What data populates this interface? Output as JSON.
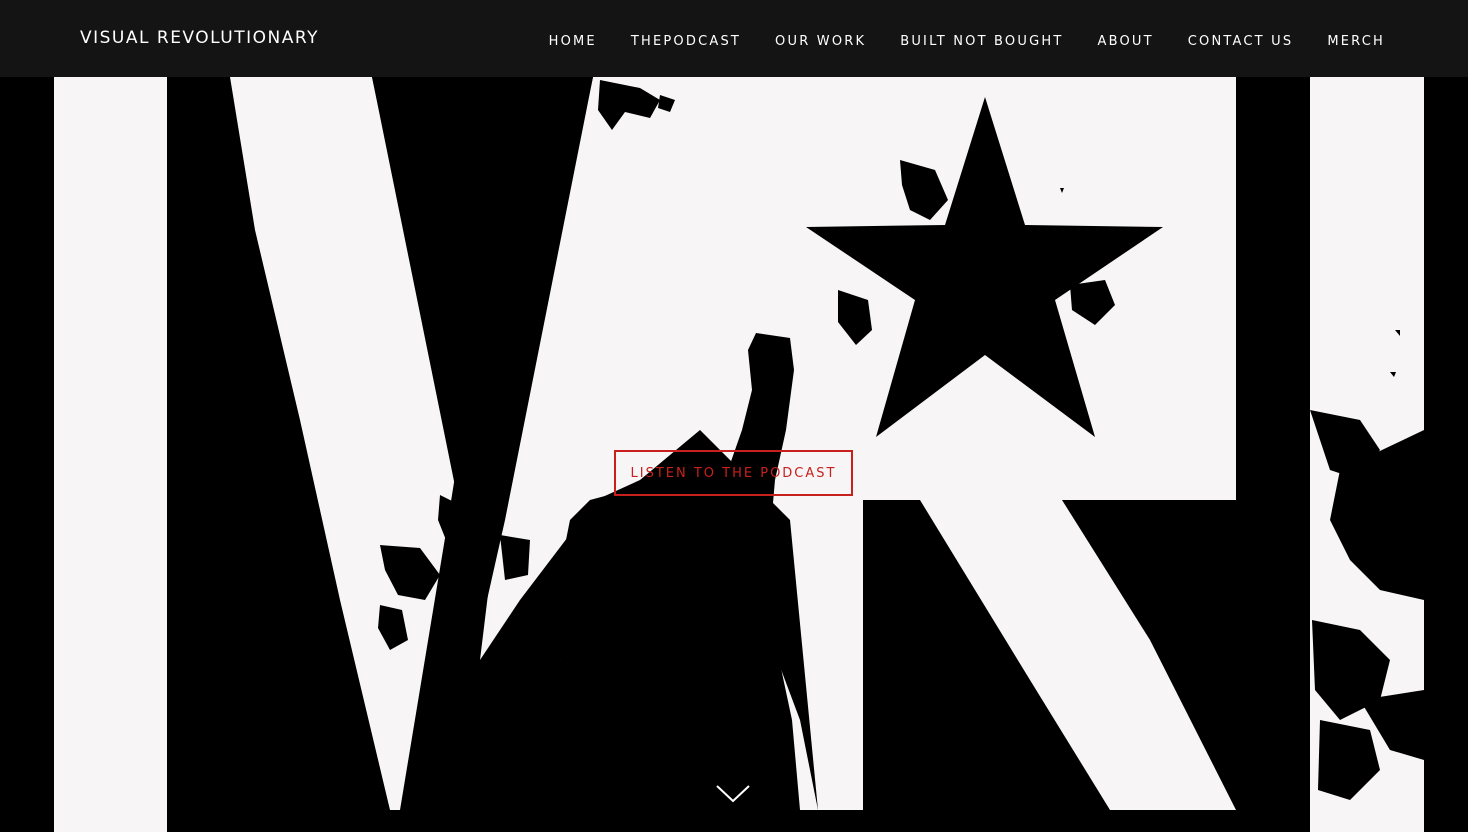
{
  "brand": {
    "title": "VISUAL REVOLUTIONARY"
  },
  "nav": {
    "items": [
      {
        "label": "HOME"
      },
      {
        "label": "THEPODCAST"
      },
      {
        "label": "OUR WORK"
      },
      {
        "label": "BUILT NOT BOUGHT"
      },
      {
        "label": "ABOUT"
      },
      {
        "label": "CONTACT US"
      },
      {
        "label": "MERCH"
      }
    ]
  },
  "hero": {
    "cta_label": "LISTEN TO THE PODCAST",
    "scroll_icon": "chevron-down-icon",
    "logo_icon": "vr-star-fist-logo"
  },
  "colors": {
    "navbar_bg": "#141414",
    "nav_text": "#ffffff",
    "cta_accent": "#c8211d",
    "hero_light": "#f7f5f6",
    "hero_dark": "#000000"
  }
}
